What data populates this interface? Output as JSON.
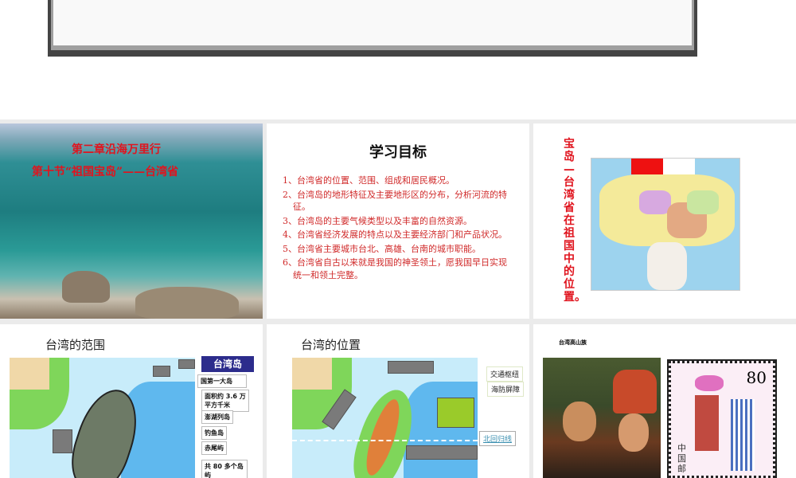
{
  "slides": [
    {
      "title_line1": "第二章沿海万里行",
      "title_line2": "第十节“祖国宝岛”——台湾省"
    },
    {
      "title": "学习目标",
      "items": [
        "1、台湾省的位置、范围、组成和居民概况。",
        "2、台湾岛的地形特征及主要地形区的分布，分析河流的特征。",
        "3、台湾岛的主要气候类型以及丰富的自然资源。",
        "4、台湾省经济发展的特点以及主要经济部门和产品状况。",
        "5、台湾省主要城市台北、高雄、台南的城市职能。",
        "6、台湾省自古以来就是我国的神圣领土，愿我国早日实现统一和领土完整。"
      ]
    },
    {
      "title": "宝岛—台湾省在祖国中的位置。"
    },
    {
      "title": "台湾的范围",
      "heading": "台湾岛",
      "boxes": [
        "国第一大岛",
        "面积约 3.6 万平方千米",
        "澎湖列岛",
        "钓鱼岛",
        "赤尾屿",
        "共 80 多个岛屿"
      ]
    },
    {
      "title": "台湾的位置",
      "labels": [
        "交通枢纽",
        "海防屏障"
      ],
      "link": "北回归线"
    },
    {
      "title": "台湾高山族",
      "stamp_value": "80",
      "stamp_country": "中国邮"
    }
  ]
}
